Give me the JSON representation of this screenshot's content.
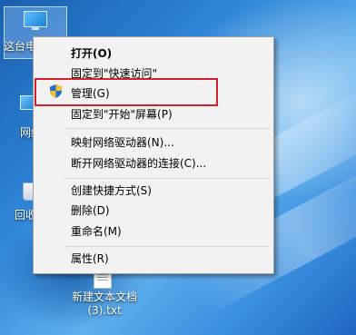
{
  "desktop": {
    "icons": [
      {
        "label": "这台电脑",
        "icon": "this-pc-icon"
      },
      {
        "label": "网络",
        "icon": "network-icon"
      },
      {
        "label": "回收站",
        "icon": "recycle-bin-icon"
      },
      {
        "label_line1": "新建文本文档",
        "label_line2": "(3).txt",
        "icon": "text-file-icon"
      }
    ]
  },
  "context_menu": {
    "items": [
      {
        "label": "打开(O)",
        "bold": true
      },
      {
        "label": "固定到\"快速访问\""
      },
      {
        "label": "管理(G)",
        "icon": "uac-shield-icon"
      },
      {
        "label": "固定到\"开始\"屏幕(P)"
      },
      {
        "label": "映射网络驱动器(N)..."
      },
      {
        "label": "断开网络驱动器的连接(C)..."
      },
      {
        "label": "创建快捷方式(S)"
      },
      {
        "label": "删除(D)"
      },
      {
        "label": "重命名(M)"
      },
      {
        "label": "属性(R)"
      }
    ]
  },
  "annotation": {
    "highlight_color": "#d3202a",
    "highlight_target": "管理(G)"
  },
  "colors": {
    "menu_bg": "#f2f2f2",
    "menu_border": "#a0a0a0",
    "desktop_blue": "#2f86d8"
  }
}
